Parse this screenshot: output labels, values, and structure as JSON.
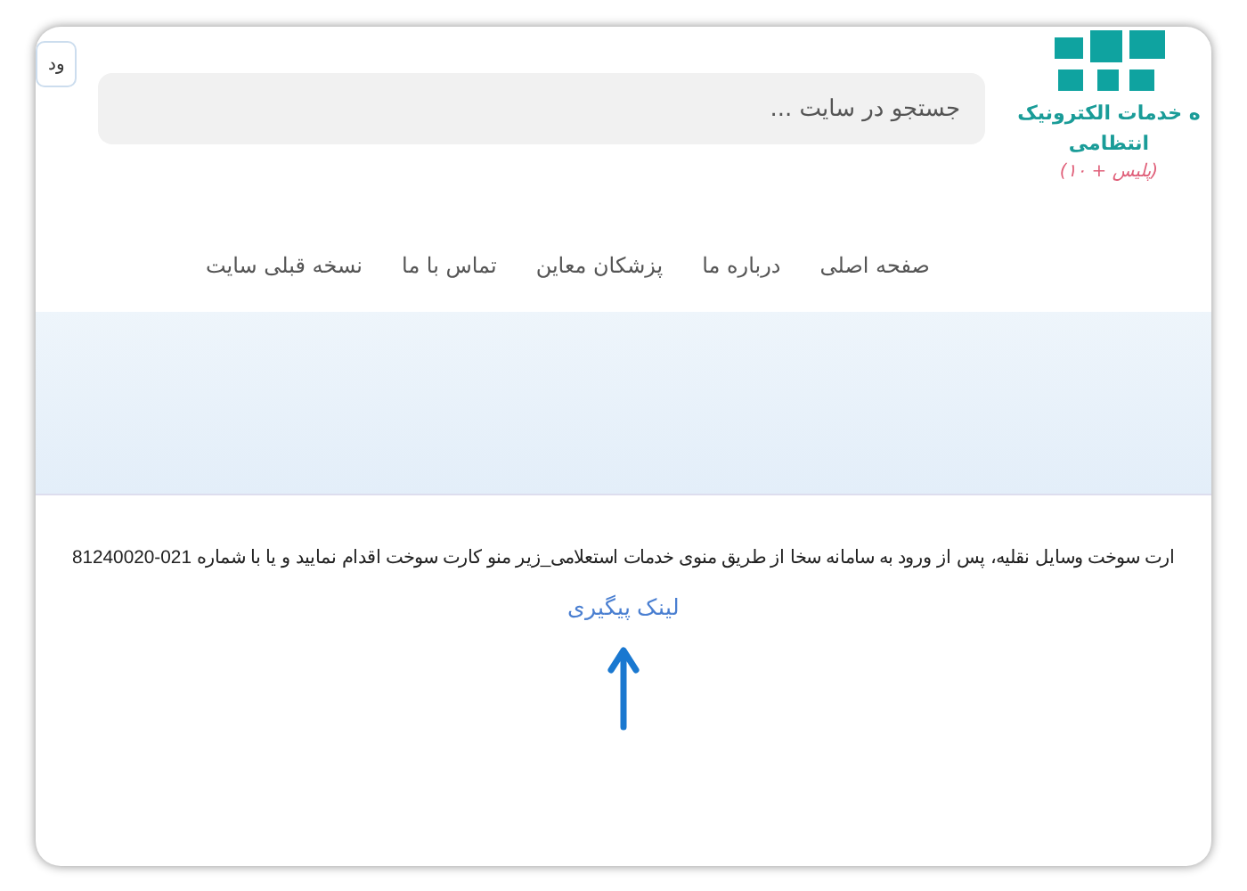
{
  "header": {
    "login_button": "ود",
    "search": {
      "placeholder": "جستجو در سایت ..."
    },
    "brand": {
      "line_1": "ه خدمات الکترونیک",
      "line_2": "انتظامی",
      "tagline": "(پلیس + ۱۰)"
    }
  },
  "nav": {
    "items": [
      {
        "label": "صفحه اصلی"
      },
      {
        "label": "درباره ما"
      },
      {
        "label": "پزشکان معاین"
      },
      {
        "label": "تماس با ما"
      },
      {
        "label": "نسخه قبلی سایت"
      }
    ]
  },
  "content": {
    "paragraph": "ارت سوخت وسایل نقلیه، پس از ورود به سامانه سخا از طریق منوی خدمات استعلامی_زیر منو کارت سوخت اقدام نمایید و یا با شماره 021-81240020",
    "link": "لینک پیگیری"
  }
}
